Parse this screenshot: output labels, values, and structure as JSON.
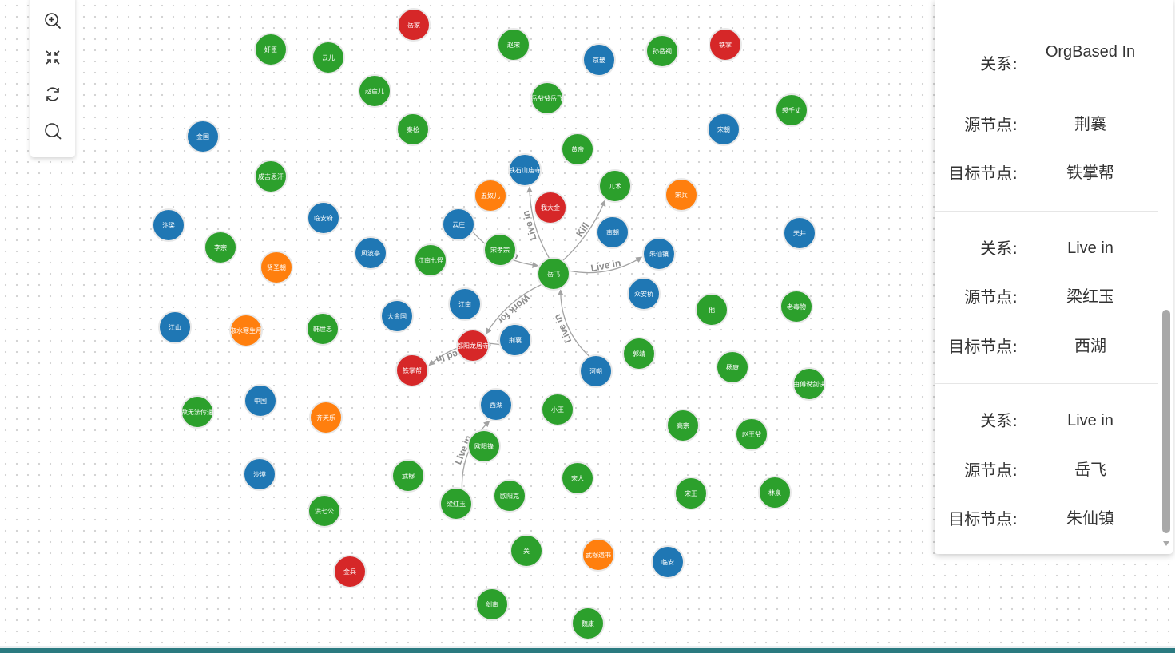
{
  "colors": {
    "green": "#2ca02c",
    "blue": "#1f77b4",
    "red": "#d62728",
    "orange": "#ff7f0e",
    "edge": "#a3a3a3",
    "edge_label": "#8c8c8c"
  },
  "toolbar": {
    "zoom_in_icon": "zoom-in-icon",
    "fit_view_icon": "fit-view-icon",
    "refresh_icon": "refresh-icon",
    "search_icon": "search-icon"
  },
  "graph": {
    "nodes": [
      {
        "id": "yuejia",
        "label": "岳家",
        "color": "red"
      },
      {
        "id": "jianchen",
        "label": "奸臣",
        "color": "green"
      },
      {
        "id": "yuner",
        "label": "云儿",
        "color": "green"
      },
      {
        "id": "zhaosong",
        "label": "赵宋",
        "color": "green"
      },
      {
        "id": "jingdu",
        "label": "京畿",
        "color": "blue"
      },
      {
        "id": "sunyueci",
        "label": "孙岳祠",
        "color": "green"
      },
      {
        "id": "tiezhang",
        "label": "铁掌",
        "color": "red"
      },
      {
        "id": "zhaohuaner",
        "label": "赵宦儿",
        "color": "green"
      },
      {
        "id": "yueyeyeyuefei",
        "label": "岳爷爷岳飞",
        "color": "green"
      },
      {
        "id": "jinguo",
        "label": "金国",
        "color": "blue"
      },
      {
        "id": "qinhui",
        "label": "秦桧",
        "color": "green"
      },
      {
        "id": "songchao",
        "label": "宋朝",
        "color": "blue"
      },
      {
        "id": "qiqianzhang",
        "label": "裘千丈",
        "color": "green"
      },
      {
        "id": "huangdi",
        "label": "黄帝",
        "color": "green"
      },
      {
        "id": "chengjisihan",
        "label": "成吉思汗",
        "color": "green"
      },
      {
        "id": "tieshishanmiao",
        "label": "铁石山庙寺",
        "color": "blue"
      },
      {
        "id": "wuyanger",
        "label": "五奴儿",
        "color": "orange"
      },
      {
        "id": "wodajin",
        "label": "我大金",
        "color": "red"
      },
      {
        "id": "wuzhu",
        "label": "兀术",
        "color": "green"
      },
      {
        "id": "songbing",
        "label": "宋兵",
        "color": "orange"
      },
      {
        "id": "bianliang",
        "label": "汴梁",
        "color": "blue"
      },
      {
        "id": "linanfu",
        "label": "临安府",
        "color": "blue"
      },
      {
        "id": "yunzhuang",
        "label": "云庄",
        "color": "blue"
      },
      {
        "id": "nanchao",
        "label": "南朝",
        "color": "blue"
      },
      {
        "id": "tianjing",
        "label": "天井",
        "color": "blue"
      },
      {
        "id": "lizong",
        "label": "李宗",
        "color": "green"
      },
      {
        "id": "xianshengchao",
        "label": "贤圣朝",
        "color": "orange"
      },
      {
        "id": "fengbolting",
        "label": "风波亭",
        "color": "blue"
      },
      {
        "id": "jiangnanqiguai",
        "label": "江南七怪",
        "color": "green"
      },
      {
        "id": "songxiaozong",
        "label": "宋孝宗",
        "color": "green"
      },
      {
        "id": "yuefei",
        "label": "岳飞",
        "color": "green"
      },
      {
        "id": "zhuxianzhen",
        "label": "朱仙镇",
        "color": "blue"
      },
      {
        "id": "jiangnan",
        "label": "江南",
        "color": "blue"
      },
      {
        "id": "zhonganqiao",
        "label": "众安桥",
        "color": "blue"
      },
      {
        "id": "ta",
        "label": "他",
        "color": "green"
      },
      {
        "id": "laodujing",
        "label": "老毒物",
        "color": "green"
      },
      {
        "id": "jiangshan",
        "label": "江山",
        "color": "blue"
      },
      {
        "id": "shuishui",
        "label": "淑水寒生月",
        "color": "orange"
      },
      {
        "id": "hanshizhong",
        "label": "韩世忠",
        "color": "green"
      },
      {
        "id": "dajinguo",
        "label": "大金国",
        "color": "blue"
      },
      {
        "id": "duyanglongju",
        "label": "都阳龙居寺",
        "color": "red"
      },
      {
        "id": "jingxiang",
        "label": "荆襄",
        "color": "blue"
      },
      {
        "id": "guojing",
        "label": "郭靖",
        "color": "green"
      },
      {
        "id": "yangkang",
        "label": "杨康",
        "color": "green"
      },
      {
        "id": "tiezhangbang",
        "label": "铁掌帮",
        "color": "red"
      },
      {
        "id": "hexu",
        "label": "河朔",
        "color": "blue"
      },
      {
        "id": "chuanshuo",
        "label": "由傅说剑诀",
        "color": "green"
      },
      {
        "id": "shuwufa",
        "label": "数无法传递",
        "color": "green"
      },
      {
        "id": "zhongguo",
        "label": "中国",
        "color": "blue"
      },
      {
        "id": "qitianle",
        "label": "齐天乐",
        "color": "orange"
      },
      {
        "id": "xihu",
        "label": "西湖",
        "color": "blue"
      },
      {
        "id": "xiaowang",
        "label": "小王",
        "color": "green"
      },
      {
        "id": "gaozong",
        "label": "高宗",
        "color": "green"
      },
      {
        "id": "zhaowangye",
        "label": "赵王爷",
        "color": "green"
      },
      {
        "id": "ouyangfeng",
        "label": "欧阳锋",
        "color": "green"
      },
      {
        "id": "shamo",
        "label": "沙漠",
        "color": "blue"
      },
      {
        "id": "wumu",
        "label": "武穆",
        "color": "green"
      },
      {
        "id": "songren",
        "label": "宋人",
        "color": "green"
      },
      {
        "id": "lianghongyu",
        "label": "梁红玉",
        "color": "green"
      },
      {
        "id": "ouyangke",
        "label": "欧阳克",
        "color": "green"
      },
      {
        "id": "songwang",
        "label": "宋王",
        "color": "green"
      },
      {
        "id": "linquan",
        "label": "林泉",
        "color": "green"
      },
      {
        "id": "hongqigong",
        "label": "洪七公",
        "color": "green"
      },
      {
        "id": "guan",
        "label": "关",
        "color": "green"
      },
      {
        "id": "wumuyishu",
        "label": "武穆遗书",
        "color": "orange"
      },
      {
        "id": "linan",
        "label": "临安",
        "color": "blue"
      },
      {
        "id": "jinbing",
        "label": "金兵",
        "color": "red"
      },
      {
        "id": "jiannan",
        "label": "剑南",
        "color": "green"
      },
      {
        "id": "guiling",
        "label": "魏康",
        "color": "green"
      }
    ],
    "edges": [
      {
        "label": "Live in"
      },
      {
        "label": "Live in"
      },
      {
        "label": "Kill"
      },
      {
        "label": "Live in"
      },
      {
        "label": "Work for"
      },
      {
        "label": "Live in"
      },
      {
        "label": "OrgBased In"
      },
      {
        "label": "Live in"
      }
    ]
  },
  "panel": {
    "relations": [
      {
        "relation_label": "关系:",
        "relation": "OrgBased In",
        "source_label": "源节点:",
        "source": "荆襄",
        "target_label": "目标节点:",
        "target": "铁掌帮"
      },
      {
        "relation_label": "关系:",
        "relation": "Live in",
        "source_label": "源节点:",
        "source": "梁红玉",
        "target_label": "目标节点:",
        "target": "西湖"
      },
      {
        "relation_label": "关系:",
        "relation": "Live in",
        "source_label": "源节点:",
        "source": "岳飞",
        "target_label": "目标节点:",
        "target": "朱仙镇"
      }
    ]
  }
}
